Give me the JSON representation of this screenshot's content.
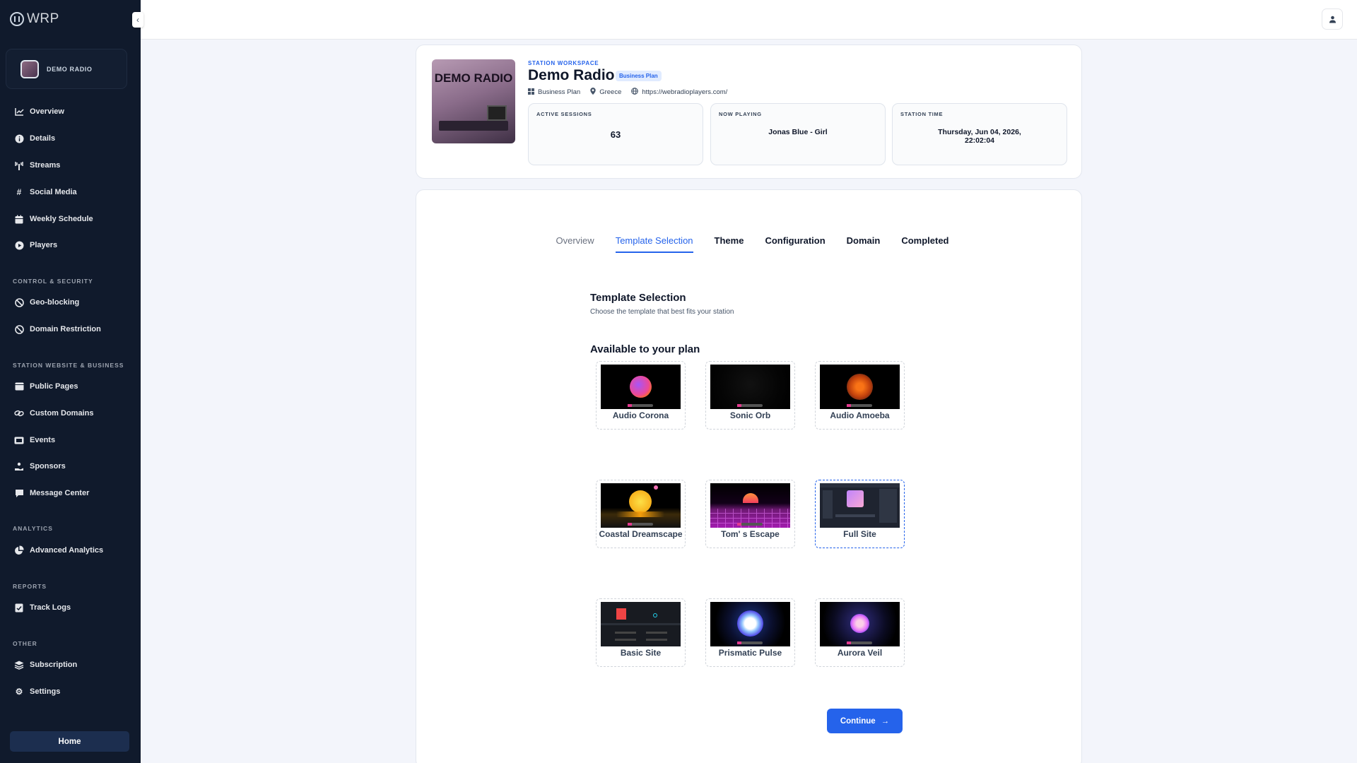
{
  "brand": {
    "name": "WRP"
  },
  "sidebar": {
    "station_name": "DEMO RADIO",
    "items": [
      {
        "label": "Overview",
        "icon": "chart-line-icon"
      },
      {
        "label": "Details",
        "icon": "info-icon"
      },
      {
        "label": "Streams",
        "icon": "broadcast-tower-icon"
      },
      {
        "label": "Social Media",
        "icon": "hashtag-icon"
      },
      {
        "label": "Weekly Schedule",
        "icon": "calendar-icon"
      },
      {
        "label": "Players",
        "icon": "play-circle-icon"
      }
    ],
    "sections": {
      "control": "CONTROL & SECURITY",
      "website": "STATION WEBSITE & BUSINESS",
      "analytics": "ANALYTICS",
      "reports": "REPORTS",
      "other": "OTHER"
    },
    "control_items": [
      {
        "label": "Geo-blocking",
        "icon": "globe-block-icon"
      },
      {
        "label": "Domain Restriction",
        "icon": "ban-icon"
      }
    ],
    "website_items": [
      {
        "label": "Public Pages",
        "icon": "browser-window-icon"
      },
      {
        "label": "Custom Domains",
        "icon": "link-icon"
      },
      {
        "label": "Events",
        "icon": "ticket-icon"
      },
      {
        "label": "Sponsors",
        "icon": "hand-holding-icon"
      },
      {
        "label": "Message Center",
        "icon": "message-icon"
      }
    ],
    "analytics_items": [
      {
        "label": "Advanced Analytics",
        "icon": "pie-chart-icon"
      }
    ],
    "reports_items": [
      {
        "label": "Track Logs",
        "icon": "clipboard-check-icon"
      }
    ],
    "other_items": [
      {
        "label": "Subscription",
        "icon": "layers-icon"
      },
      {
        "label": "Settings",
        "icon": "gears-icon"
      }
    ],
    "home_label": "Home"
  },
  "header": {
    "kicker": "STATION WORKSPACE",
    "title": "Demo Radio",
    "badge": "Business Plan",
    "cover_text": "DEMO RADIO",
    "meta": {
      "plan": "Business Plan",
      "country": "Greece",
      "url": "https://webradioplayers.com/"
    },
    "stats": {
      "sessions_label": "ACTIVE SESSIONS",
      "sessions_value": "63",
      "playing_label": "NOW PLAYING",
      "playing_value": "Jonas Blue - Girl",
      "time_label": "STATION TIME",
      "time_value_1": "Thursday, Jun 04, 2026,",
      "time_value_2": "22:02:04"
    }
  },
  "wizard": {
    "tabs": [
      "Overview",
      "Template Selection",
      "Theme",
      "Configuration",
      "Domain",
      "Completed"
    ],
    "active_tab": "Template Selection",
    "section_title": "Template Selection",
    "section_subtitle": "Choose the template that best fits your station",
    "available_title": "Available to your plan",
    "templates": [
      {
        "name": "Audio Corona"
      },
      {
        "name": "Sonic Orb"
      },
      {
        "name": "Audio Amoeba"
      },
      {
        "name": "Coastal Dreamscape"
      },
      {
        "name": "Tom' s Escape"
      },
      {
        "name": "Full Site",
        "selected": true
      },
      {
        "name": "Basic Site"
      },
      {
        "name": "Prismatic Pulse"
      },
      {
        "name": "Aurora Veil"
      }
    ],
    "continue_label": "Continue"
  }
}
